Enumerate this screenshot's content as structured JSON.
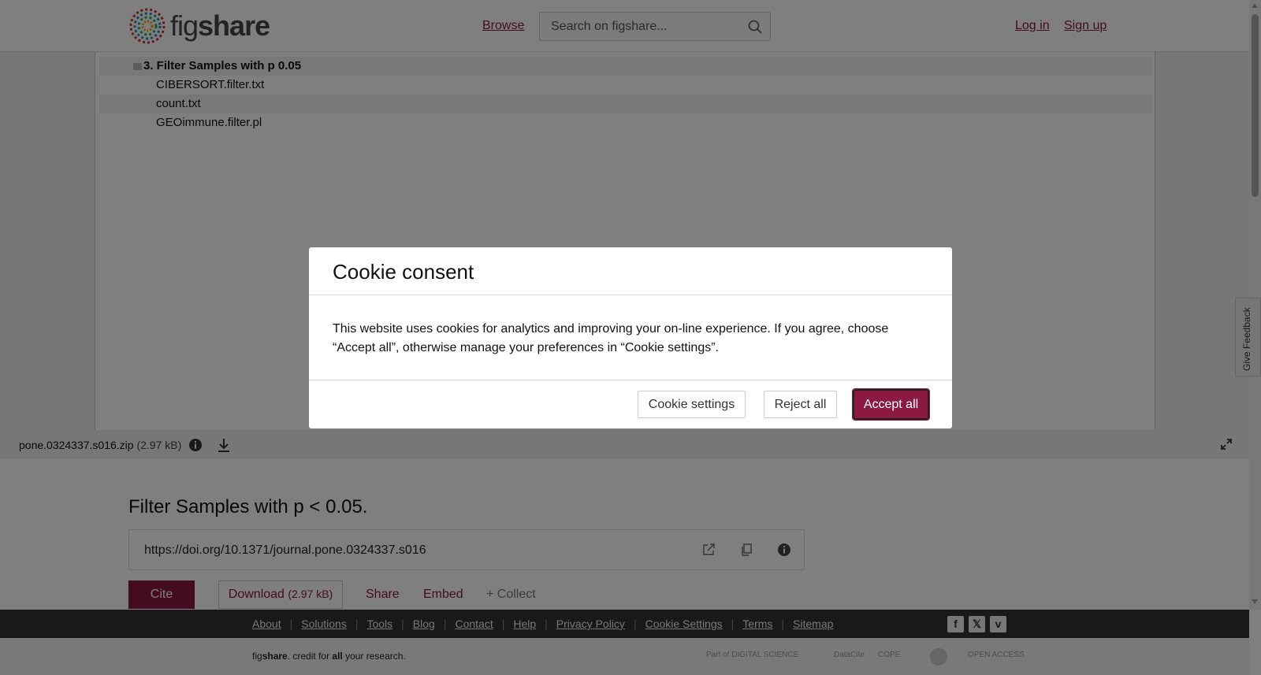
{
  "header": {
    "logo_prefix": "fig",
    "logo_suffix": "share",
    "browse_label": "Browse",
    "search_placeholder": "Search on figshare...",
    "login_label": "Log in",
    "signup_label": "Sign up"
  },
  "viewer": {
    "folder": "3. Filter Samples with p 0.05",
    "files": [
      "CIBERSORT.filter.txt",
      "count.txt",
      "GEOimmune.filter.pl"
    ],
    "file_name": "pone.0324337.s016.zip",
    "file_size": "(2.97 kB)"
  },
  "item": {
    "title": "Filter Samples with p < 0.05.",
    "doi": "https://doi.org/10.1371/journal.pone.0324337.s016",
    "cite_label": "Cite",
    "download_label": "Download",
    "download_size": "(2.97 kB)",
    "share_label": "Share",
    "embed_label": "Embed",
    "collect_label": "+ Collect"
  },
  "footer": {
    "links": [
      "About",
      "Solutions",
      "Tools",
      "Blog",
      "Contact",
      "Help",
      "Privacy Policy",
      "Cookie Settings",
      "Terms",
      "Sitemap"
    ],
    "social": [
      "f",
      "𝕏",
      "v"
    ],
    "tagline_prefix": "fig",
    "tagline_brand": "share",
    "tagline_mid": ". credit for ",
    "tagline_bold": "all",
    "tagline_end": " your research.",
    "partners": [
      "Part of DIGITAL SCIENCE",
      "DataCite",
      "COPE",
      "",
      "OPEN ACCESS"
    ]
  },
  "feedback_label": "Give Feedback",
  "cookie_modal": {
    "title": "Cookie consent",
    "body": "This website uses cookies for analytics and improving your on-line experience. If you agree, choose “Accept all”, otherwise manage your preferences in “Cookie settings”.",
    "settings_label": "Cookie settings",
    "reject_label": "Reject all",
    "accept_label": "Accept all"
  },
  "colors": {
    "accent": "#8b1942",
    "footer_bg": "#333333"
  }
}
